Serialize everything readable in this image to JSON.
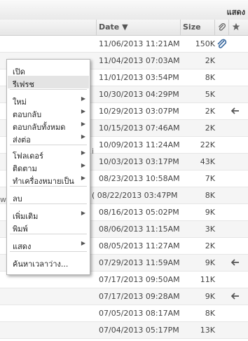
{
  "top": {
    "show_label": "แสดง"
  },
  "columns": {
    "date": "Date ▼",
    "size": "Size"
  },
  "rows": [
    {
      "date": "11/06/2013 11:21AM",
      "size": "150K",
      "attachment": true,
      "flag": ""
    },
    {
      "date": "11/04/2013 07:03AM",
      "size": "2K",
      "attachment": false,
      "flag": ""
    },
    {
      "date": "11/01/2013 03:54PM",
      "size": "8K",
      "attachment": false,
      "flag": ""
    },
    {
      "date": "10/30/2013 04:29PM",
      "size": "5K",
      "attachment": false,
      "flag": ""
    },
    {
      "date": "10/29/2013 03:07PM",
      "size": "2K",
      "attachment": false,
      "flag": "reply"
    },
    {
      "date": "10/15/2013 07:46AM",
      "size": "2K",
      "attachment": false,
      "flag": ""
    },
    {
      "date": "10/09/2013 11:24AM",
      "size": "22K",
      "attachment": false,
      "flag": ""
    },
    {
      "date": "10/03/2013 03:17PM",
      "size": "43K",
      "attachment": false,
      "flag": ""
    },
    {
      "date": "08/23/2013 10:58AM",
      "size": "7K",
      "attachment": false,
      "flag": ""
    },
    {
      "date": "( 08/22/2013 03:47PM",
      "size": "8K",
      "attachment": false,
      "flag": ""
    },
    {
      "date": "08/16/2013 05:02PM",
      "size": "9K",
      "attachment": false,
      "flag": ""
    },
    {
      "date": "08/06/2013 11:15AM",
      "size": "3K",
      "attachment": false,
      "flag": ""
    },
    {
      "date": "08/05/2013 11:27AM",
      "size": "2K",
      "attachment": false,
      "flag": ""
    },
    {
      "date": "07/29/2013 11:59AM",
      "size": "9K",
      "attachment": false,
      "flag": "reply"
    },
    {
      "date": "07/17/2013 09:50AM",
      "size": "11K",
      "attachment": false,
      "flag": ""
    },
    {
      "date": "07/17/2013 09:28AM",
      "size": "9K",
      "attachment": false,
      "flag": "reply"
    },
    {
      "date": "07/05/2013 08:17AM",
      "size": "8K",
      "attachment": false,
      "flag": ""
    },
    {
      "date": "07/04/2013 05:17PM",
      "size": "13K",
      "attachment": false,
      "flag": ""
    }
  ],
  "context_menu": {
    "items": [
      {
        "label": "เปิด",
        "submenu": false
      },
      {
        "label": "รีเฟรช",
        "submenu": false
      },
      {
        "label": "ใหม่",
        "submenu": true
      },
      {
        "label": "ตอบกลับ",
        "submenu": true
      },
      {
        "label": "ตอบกลับทั้งหมด",
        "submenu": true
      },
      {
        "label": "ส่งต่อ",
        "submenu": true
      },
      {
        "label": "โฟลเดอร์",
        "submenu": true
      },
      {
        "label": "ติดตาม",
        "submenu": true
      },
      {
        "label": "ทำเครื่องหมายเป็น",
        "submenu": true
      },
      {
        "label": "ลบ",
        "submenu": false
      },
      {
        "label": "เพิ่มเติม",
        "submenu": true
      },
      {
        "label": "พิมพ์",
        "submenu": false
      },
      {
        "label": "แสดง",
        "submenu": true
      },
      {
        "label": "ค้นหาเวลาว่าง...",
        "submenu": false
      }
    ]
  },
  "left_cut_chars": [
    "i",
    "w"
  ]
}
